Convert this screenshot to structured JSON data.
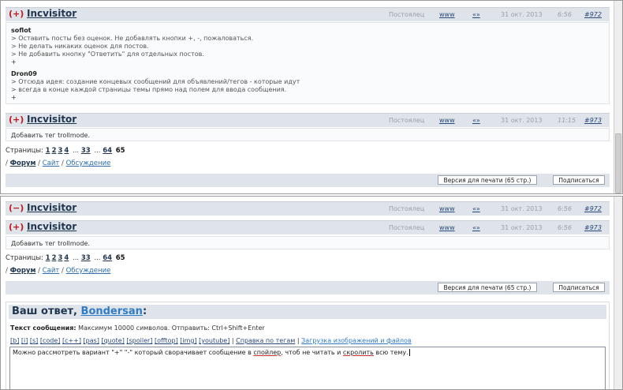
{
  "frame1": {
    "post1": {
      "sign": "(+)",
      "author": "Incvisitor",
      "role": "Постоялец",
      "www": "www",
      "quote": "«»",
      "date": "31 окт. 2013",
      "time": "6:56",
      "num": "#972",
      "body": {
        "q1_name": "soflot",
        "q1_lines": [
          "> Оставить посты без оценок. Не добавлять кнопки +, -, пожаловаться.",
          "> Не делать никаких оценок для постов.",
          "> Не добавить кнопку \"Ответить\" для отдельных постов.",
          "+"
        ],
        "q2_name": "Dron09",
        "q2_lines": [
          "> Отсюда идея: создание концевых сообщений для объявлений/тегов - которые идут",
          "> всегда в конце каждой страницы темы прямо над полем для ввода сообщения.",
          "+"
        ]
      }
    },
    "post2": {
      "sign": "(+)",
      "author": "Incvisitor",
      "role": "Постоялец",
      "www": "www",
      "quote": "«»",
      "date": "31 окт. 2013",
      "time": "11:15",
      "num": "#973",
      "body": "Добавить тег trollmode."
    },
    "pages": {
      "label": "Страницы:",
      "p1": "1",
      "p2": "2",
      "p3": "3",
      "p4": "4",
      "dots1": "...",
      "p33": "33",
      "dots2": "...",
      "p64": "64",
      "current": "65"
    },
    "crumbs": {
      "slash": "/",
      "forum": "Форум",
      "site": "Сайт",
      "discussion": "Обсуждение"
    },
    "print_button": "Версия для печати (65 стр.)",
    "subscribe_button": "Подписаться"
  },
  "frame2": {
    "post1": {
      "sign": "(−)",
      "author": "Incvisitor",
      "role": "Постоялец",
      "www": "www",
      "quote": "«»",
      "date": "31 окт. 2013",
      "time": "6:56",
      "num": "#972"
    },
    "post2": {
      "sign": "(+)",
      "author": "Incvisitor",
      "role": "Постоялец",
      "www": "www",
      "quote": "«»",
      "date": "31 окт. 2013",
      "time": "6:56",
      "num": "#973",
      "body": "Добавить тег trollmode."
    },
    "pages": {
      "label": "Страницы:",
      "p1": "1",
      "p2": "2",
      "p3": "3",
      "p4": "4",
      "dots1": "...",
      "p33": "33",
      "dots2": "...",
      "p64": "64",
      "current": "65"
    },
    "crumbs": {
      "slash": "/",
      "forum": "Форум",
      "site": "Сайт",
      "discussion": "Обсуждение"
    },
    "print_button": "Версия для печати (65 стр.)",
    "subscribe_button": "Подписаться",
    "reply": {
      "title_prefix": "Ваш ответ,",
      "user": "Bondersan",
      "title_suffix": ":",
      "info_label": "Текст сообщения:",
      "info_text": "Максимум 10000 символов. Отправить: Ctrl+Shift+Enter",
      "tags": [
        "[b]",
        "[i]",
        "[s]",
        "[code]",
        "[c++]",
        "[pas]",
        "[quote]",
        "[spoiler]",
        "[offtop]",
        "[img]",
        "[youtube]"
      ],
      "sep": "|",
      "help_link": "Справка по тегам",
      "upload_link": "Загрузка изображений и файлов",
      "text_part1": "Можно рассмотреть вариант \"+\" \"-\" который сворачивает сообщение в ",
      "text_word1": "спойлер",
      "text_part2": ", чтоб не читать и ",
      "text_word2": "скролить",
      "text_part3": " всю тему."
    }
  }
}
